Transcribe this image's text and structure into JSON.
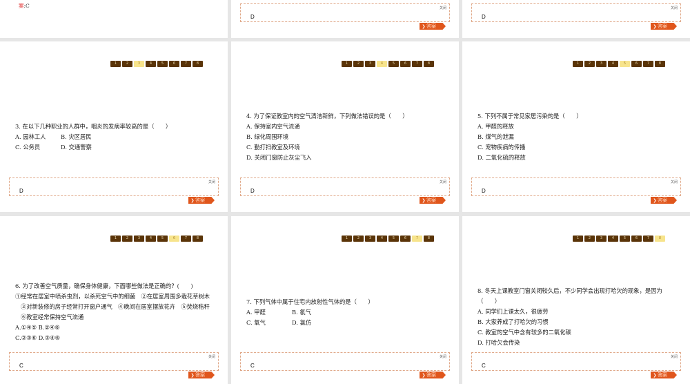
{
  "nav_labels": [
    "1",
    "2",
    "3",
    "4",
    "5",
    "6",
    "7",
    "8"
  ],
  "close_label": "关闭",
  "answer_button_label": "答案",
  "colors": {
    "nav": "#5a3408",
    "nav_active": "#f7e48c",
    "answer_button": "#e0561c",
    "border": "#e0a888"
  },
  "top_row": [
    {
      "answer_prefix": "案",
      "answer_text": ":C"
    },
    {
      "answer": "D"
    },
    {
      "answer": "D"
    }
  ],
  "panels": [
    {
      "active": 3,
      "answer": "D",
      "lines": [
        [
          "3. 在以下几种职业的人群中，咽炎的发病率较高的是（　　）"
        ],
        [
          "A. 园林工人",
          "B. 灾区居民"
        ],
        [
          "C. 公务员",
          "D. 交通警察"
        ]
      ]
    },
    {
      "active": 4,
      "answer": "D",
      "lines": [
        [
          "4. 为了保证教室内的空气清洁新鲜，下列做法错误的是（　　）"
        ],
        [
          "A. 保持室内空气流通"
        ],
        [
          "B. 绿化周围环境"
        ],
        [
          "C. 勤打扫教室及环境"
        ],
        [
          "D. 关闭门窗防止灰尘飞入"
        ]
      ]
    },
    {
      "active": 5,
      "answer": "D",
      "lines": [
        [
          "5. 下列不属于常见家居污染的是（　　）"
        ],
        [
          "A. 甲醛的释放"
        ],
        [
          "B. 煤气的泄漏"
        ],
        [
          "C. 宠物疾病的传播"
        ],
        [
          "D. 二氧化硫的释放"
        ]
      ]
    },
    {
      "active": 6,
      "answer": "C",
      "lines": [
        [
          "6. 为了改善空气质量，确保身体健康，下面哪些做法是正确的？(　　)"
        ],
        [
          "①经常在居室中喷杀虫剂，以杀死空气中的细菌　②在居室周围多栽花草树木"
        ],
        [
          "③对新装修的房子经常打开窗户通气　④晚间在居室摆放花卉　⑤焚烧秸秆"
        ],
        [
          "⑥教室经常保持空气流通"
        ],
        [
          "A.①④⑤  B.②④⑥"
        ],
        [
          "C.②③⑥  D.③④⑥"
        ]
      ]
    },
    {
      "active": 7,
      "answer": "C",
      "lines": [
        [
          "7. 下列气体中属于住宅内放射性气体的是（　　）"
        ],
        [
          "A. 甲醛",
          "B. 氡气"
        ],
        [
          "C. 氧气",
          "D. 氯仿"
        ]
      ]
    },
    {
      "active": 8,
      "answer": "C",
      "lines": [
        [
          "8. 冬天上课教室门窗关闭较久后，不少同学会出现打哈欠的现象，是因为"
        ],
        [
          "（　　）"
        ],
        [
          "A. 同学们上课太久，很疲劳"
        ],
        [
          "B. 大家养成了打哈欠的习惯"
        ],
        [
          "C. 教室的空气中含有较多的二氧化碳"
        ],
        [
          "D. 打哈欠会传染"
        ]
      ]
    }
  ]
}
